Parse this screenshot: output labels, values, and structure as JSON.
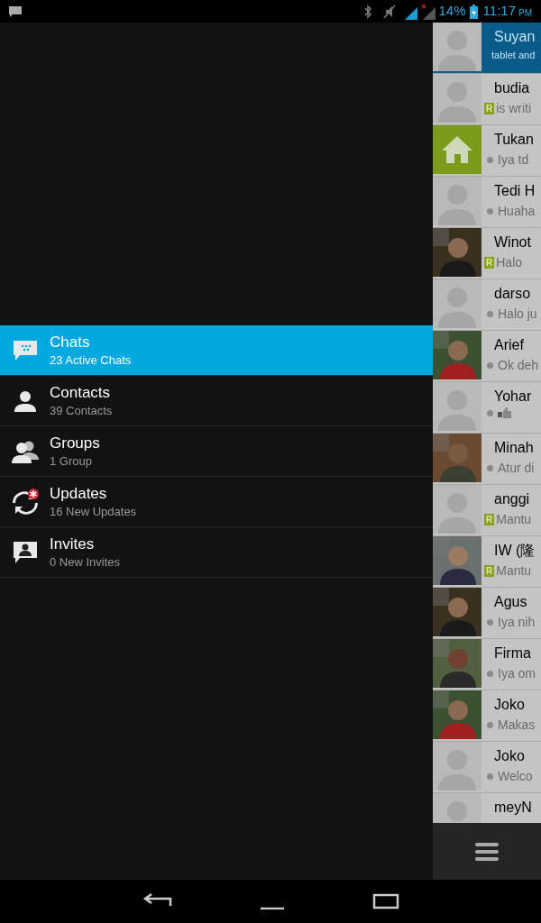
{
  "status_bar": {
    "battery": "14%",
    "time": "11:17",
    "ampm": "PM"
  },
  "drawer": {
    "items": [
      {
        "kind": "chats",
        "label": "Chats",
        "subtitle": "23 Active Chats",
        "selected": true
      },
      {
        "kind": "contacts",
        "label": "Contacts",
        "subtitle": "39 Contacts",
        "selected": false
      },
      {
        "kind": "groups",
        "label": "Groups",
        "subtitle": "1 Group",
        "selected": false
      },
      {
        "kind": "updates",
        "label": "Updates",
        "subtitle": "16 New Updates",
        "selected": false
      },
      {
        "kind": "invites",
        "label": "Invites",
        "subtitle": "0 New Invites",
        "selected": false
      }
    ]
  },
  "chats": [
    {
      "name": "Suyan",
      "preview": "tablet and",
      "avatar": {
        "kind": "silhouette"
      },
      "selected": true
    },
    {
      "name": "budia",
      "preview": "is writi",
      "badge": "R",
      "avatar": {
        "kind": "silhouette"
      },
      "selected": false
    },
    {
      "name": "Tukan",
      "preview": "Iya td",
      "dot": true,
      "avatar": {
        "kind": "house"
      },
      "selected": false
    },
    {
      "name": "Tedi H",
      "preview": "Huaha",
      "dot": true,
      "avatar": {
        "kind": "silhouette"
      },
      "selected": false
    },
    {
      "name": "Winot",
      "preview": "Halo",
      "badge": "R",
      "selected": false
    },
    {
      "name": "darso",
      "preview": "Halo ju",
      "dot": true,
      "avatar": {
        "kind": "silhouette"
      },
      "selected": false
    },
    {
      "name": "Arief",
      "preview": "Ok deh",
      "dot": true,
      "selected": false
    },
    {
      "name": "Yohar",
      "attachment": {
        "kind": "emoticon"
      },
      "dot": true,
      "avatar": {
        "kind": "silhouette"
      },
      "selected": false
    },
    {
      "name": "Minah",
      "preview": "Atur di",
      "dot": true,
      "selected": false
    },
    {
      "name": "anggi",
      "preview": "Mantu",
      "badge": "R",
      "avatar": {
        "kind": "silhouette"
      },
      "selected": false
    },
    {
      "name": "IW (隆",
      "preview": "Mantu",
      "badge": "R",
      "selected": false
    },
    {
      "name": "Agus",
      "preview": "Iya nih",
      "dot": true,
      "selected": false
    },
    {
      "name": "Firma",
      "preview": "Iya om",
      "dot": true,
      "selected": false
    },
    {
      "name": "Joko",
      "preview": "Makas",
      "dot": true,
      "selected": false
    },
    {
      "name": "Joko",
      "preview": "Welco",
      "dot": true,
      "avatar": {
        "kind": "silhouette"
      },
      "selected": false
    },
    {
      "name": "meyN",
      "avatar": {
        "kind": "silhouette"
      },
      "selected": false
    }
  ]
}
